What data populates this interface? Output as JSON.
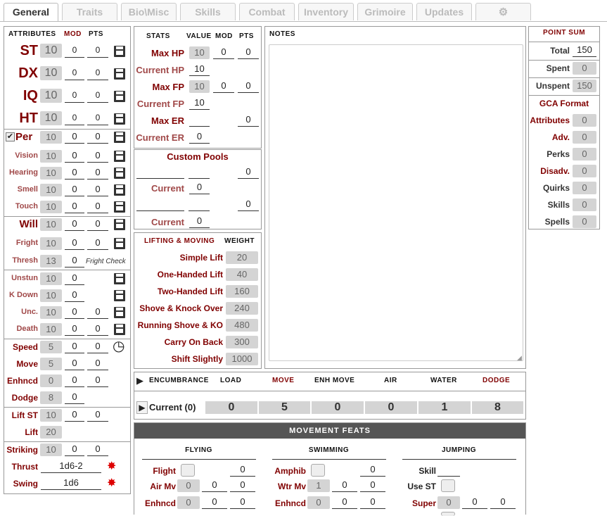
{
  "tabs": [
    "General",
    "Traits",
    "Bio\\Misc",
    "Skills",
    "Combat",
    "Inventory",
    "Grimoire",
    "Updates"
  ],
  "attr_headers": {
    "title": "ATTRIBUTES",
    "mod": "MOD",
    "pts": "PTS"
  },
  "primary": [
    {
      "label": "ST",
      "value": "10",
      "mod": "0",
      "pts": "0"
    },
    {
      "label": "DX",
      "value": "10",
      "mod": "0",
      "pts": "0"
    },
    {
      "label": "IQ",
      "value": "10",
      "mod": "0",
      "pts": "0"
    },
    {
      "label": "HT",
      "value": "10",
      "mod": "0",
      "pts": "0"
    }
  ],
  "perception": {
    "label": "Per",
    "value": "10",
    "mod": "0",
    "pts": "0"
  },
  "senses": [
    {
      "label": "Vision",
      "value": "10",
      "mod": "0",
      "pts": "0"
    },
    {
      "label": "Hearing",
      "value": "10",
      "mod": "0",
      "pts": "0"
    },
    {
      "label": "Smell",
      "value": "10",
      "mod": "0",
      "pts": "0"
    },
    {
      "label": "Touch",
      "value": "10",
      "mod": "0",
      "pts": "0"
    }
  ],
  "will": {
    "label": "Will",
    "value": "10",
    "mod": "0",
    "pts": "0"
  },
  "fright": {
    "label": "Fright",
    "value": "10",
    "mod": "0",
    "pts": "0"
  },
  "thresh": {
    "label": "Thresh",
    "value": "13",
    "mod": "0",
    "note": "Fright Check"
  },
  "checks": [
    {
      "label": "Unstun",
      "value": "10",
      "mod": "0"
    },
    {
      "label": "K Down",
      "value": "10",
      "mod": "0"
    },
    {
      "label": "Unc.",
      "value": "10",
      "mod": "0",
      "pts": "0"
    },
    {
      "label": "Death",
      "value": "10",
      "mod": "0",
      "pts": "0"
    }
  ],
  "speed": {
    "label": "Speed",
    "value": "5",
    "mod": "0",
    "pts": "0"
  },
  "move": {
    "label": "Move",
    "value": "5",
    "mod": "0",
    "pts": "0"
  },
  "enhncd": {
    "label": "Enhncd",
    "value": "0",
    "mod": "0",
    "pts": "0"
  },
  "dodge": {
    "label": "Dodge",
    "value": "8",
    "mod": "0"
  },
  "liftst": {
    "label": "Lift ST",
    "value": "10",
    "mod": "0",
    "pts": "0"
  },
  "lift": {
    "label": "Lift",
    "value": "20"
  },
  "striking": {
    "label": "Striking",
    "value": "10",
    "mod": "0",
    "pts": "0"
  },
  "thrust": {
    "label": "Thrust",
    "value": "1d6-2"
  },
  "swing": {
    "label": "Swing",
    "value": "1d6"
  },
  "stats_headers": {
    "title": "STATS",
    "value": "VALUE",
    "mod": "MOD",
    "pts": "PTS"
  },
  "stats": {
    "maxhp": {
      "label": "Max HP",
      "value": "10",
      "mod": "0",
      "pts": "0"
    },
    "curhp": {
      "label": "Current HP",
      "value": "10"
    },
    "maxfp": {
      "label": "Max FP",
      "value": "10",
      "mod": "0",
      "pts": "0"
    },
    "curfp": {
      "label": "Current FP",
      "value": "10"
    },
    "maxer": {
      "label": "Max ER",
      "pts": "0"
    },
    "curer": {
      "label": "Current ER",
      "value": "0"
    }
  },
  "pools": {
    "title": "Custom Pools",
    "pool1_pts": "0",
    "cur1_label": "Current",
    "cur1": "0",
    "pool2_pts": "0",
    "cur2_label": "Current",
    "cur2": "0"
  },
  "lifting": {
    "title": "LIFTING & MOVING",
    "weight": "WEIGHT",
    "rows": [
      {
        "label": "Simple Lift",
        "value": "20"
      },
      {
        "label": "One-Handed Lift",
        "value": "40"
      },
      {
        "label": "Two-Handed Lift",
        "value": "160"
      },
      {
        "label": "Shove & Knock Over",
        "value": "240"
      },
      {
        "label": "Running Shove & KO",
        "value": "480"
      },
      {
        "label": "Carry On Back",
        "value": "300"
      },
      {
        "label": "Shift Slightly",
        "value": "1000"
      }
    ]
  },
  "notes": {
    "title": "NOTES"
  },
  "points": {
    "title": "POINT SUM",
    "total_label": "Total",
    "total": "150",
    "spent_label": "Spent",
    "spent": "0",
    "unspent_label": "Unspent",
    "unspent": "150",
    "gca": "GCA Format",
    "rows": [
      {
        "label": "Attributes",
        "value": "0"
      },
      {
        "label": "Adv.",
        "value": "0"
      },
      {
        "label": "Perks",
        "value": "0"
      },
      {
        "label": "Disadv.",
        "value": "0"
      },
      {
        "label": "Quirks",
        "value": "0"
      },
      {
        "label": "Skills",
        "value": "0"
      },
      {
        "label": "Spells",
        "value": "0"
      }
    ]
  },
  "encumbrance": {
    "title": "ENCUMBRANCE",
    "load": "LOAD",
    "move": "MOVE",
    "enh": "ENH MOVE",
    "air": "AIR",
    "water": "WATER",
    "dodge": "DODGE",
    "current": "Current (0)",
    "vals": [
      "0",
      "5",
      "0",
      "0",
      "1",
      "8"
    ]
  },
  "feats": {
    "title": "MOVEMENT FEATS",
    "flying": "FLYING",
    "swimming": "SWIMMING",
    "jumping": "JUMPING",
    "flight": {
      "label": "Flight",
      "pts": "0"
    },
    "airmv": {
      "label": "Air Mv",
      "value": "0",
      "mod": "0",
      "pts": "0"
    },
    "fenh": {
      "label": "Enhncd",
      "value": "0",
      "mod": "0",
      "pts": "0"
    },
    "amphib": {
      "label": "Amphib",
      "pts": "0"
    },
    "wtrmv": {
      "label": "Wtr Mv",
      "value": "1",
      "mod": "0",
      "pts": "0"
    },
    "senh": {
      "label": "Enhncd",
      "value": "0",
      "mod": "0",
      "pts": "0"
    },
    "skill": {
      "label": "Skill"
    },
    "usest": {
      "label": "Use ST"
    },
    "super": {
      "label": "Super",
      "value": "0",
      "mod": "0",
      "pts": "0"
    }
  }
}
